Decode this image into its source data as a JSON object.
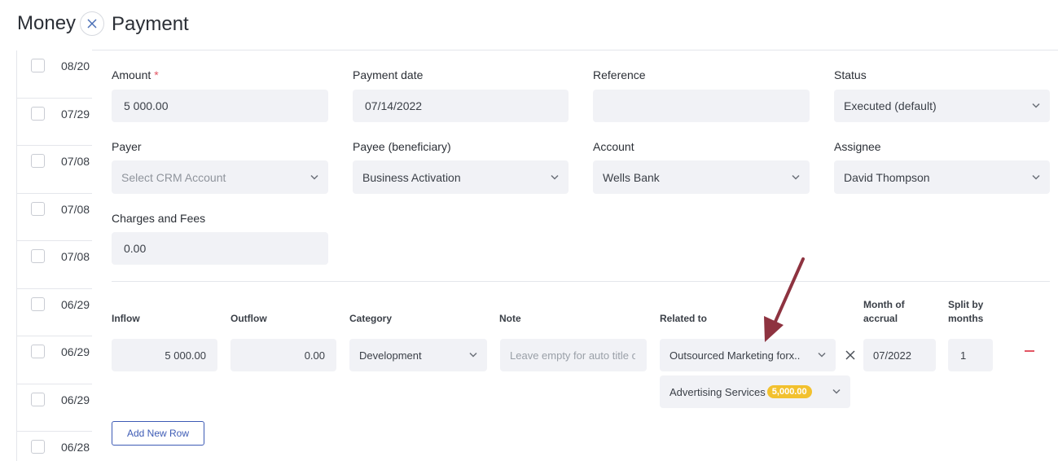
{
  "background": {
    "title": "Money",
    "rows": [
      "08/20",
      "07/29",
      "07/08",
      "07/08",
      "07/08",
      "06/29",
      "06/29",
      "06/29",
      "06/28"
    ]
  },
  "panel": {
    "title": "Payment",
    "fields": {
      "amount": {
        "label": "Amount",
        "required": "*",
        "value": "5 000.00"
      },
      "payment_date": {
        "label": "Payment date",
        "value": "07/14/2022"
      },
      "reference": {
        "label": "Reference",
        "value": ""
      },
      "status": {
        "label": "Status",
        "value": "Executed (default)"
      },
      "payer": {
        "label": "Payer",
        "placeholder": "Select CRM Account"
      },
      "payee": {
        "label": "Payee (beneficiary)",
        "value": "Business Activation"
      },
      "account": {
        "label": "Account",
        "value": "Wells Bank"
      },
      "assignee": {
        "label": "Assignee",
        "value": "David Thompson"
      },
      "charges": {
        "label": "Charges and Fees",
        "value": "0.00"
      }
    },
    "row_columns": {
      "inflow": "Inflow",
      "outflow": "Outflow",
      "category": "Category",
      "note": "Note",
      "related_to": "Related to",
      "month_of_accrual_1": "Month of",
      "month_of_accrual_2": "accrual",
      "split_by_months_1": "Split by",
      "split_by_months_2": "months"
    },
    "row": {
      "inflow": "5 000.00",
      "outflow": "0.00",
      "category": "Development",
      "note_placeholder": "Leave empty for auto title of",
      "related_to": "Outsourced Marketing forx..",
      "related_sub": "Advertising Services",
      "related_sub_badge": "5,000.00",
      "month": "07/2022",
      "split": "1"
    },
    "add_row_label": "Add New Row"
  },
  "colors": {
    "accent": "#3d5bb5",
    "badge": "#f2c12e",
    "required": "#e25563",
    "arrow": "#8e3340"
  }
}
